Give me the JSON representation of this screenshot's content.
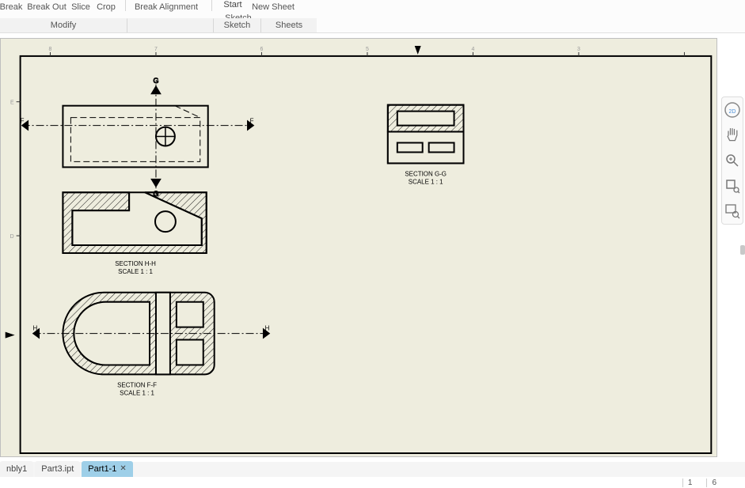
{
  "ribbon": {
    "top": {
      "break": "Break",
      "breakout": "Break Out",
      "slice": "Slice",
      "crop": "Crop",
      "breakalign": "Break Alignment",
      "startsketch_top": "Start",
      "startsketch_bottom": "Sketch",
      "newsheet": "New Sheet"
    },
    "panels": {
      "modify": "Modify",
      "sketch": "Sketch",
      "sheets": "Sheets"
    }
  },
  "section_labels": {
    "gg_title": "SECTION G-G",
    "gg_scale": "SCALE 1 : 1",
    "hh_title": "SECTION H-H",
    "hh_scale": "SCALE 1 : 1",
    "ff_title": "SECTION F-F",
    "ff_scale": "SCALE 1 : 1"
  },
  "markers": {
    "G": "G",
    "H": "H",
    "F": "F"
  },
  "tabs": {
    "t1": "nbly1",
    "t2": "Part3.ipt",
    "t3": "Part1-1"
  },
  "status": {
    "left": "1",
    "right": "6"
  },
  "icons": {
    "nav2d": "2d-navigation-icon",
    "pan": "pan-hand-icon",
    "zoom": "zoom-icon",
    "look": "look-at-icon",
    "select": "zoom-window-icon",
    "min": "minimize-icon",
    "restore": "restore-icon",
    "close": "close-icon"
  }
}
